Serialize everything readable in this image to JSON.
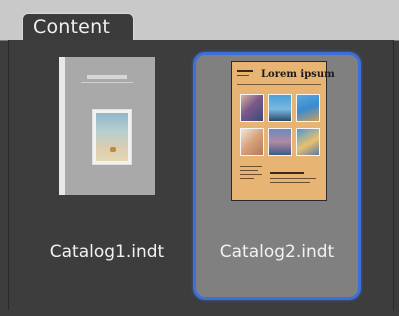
{
  "panel": {
    "tab_label": "Content"
  },
  "items": [
    {
      "file_name": "Catalog1.indt",
      "selected": false
    },
    {
      "file_name": "Catalog2.indt",
      "selected": true,
      "thumbnail_heading": "Lorem ipsum"
    }
  ],
  "colors": {
    "selection_border": "#3d6fd8",
    "selected_background": "#808080",
    "page2_background": "#e8b473"
  }
}
